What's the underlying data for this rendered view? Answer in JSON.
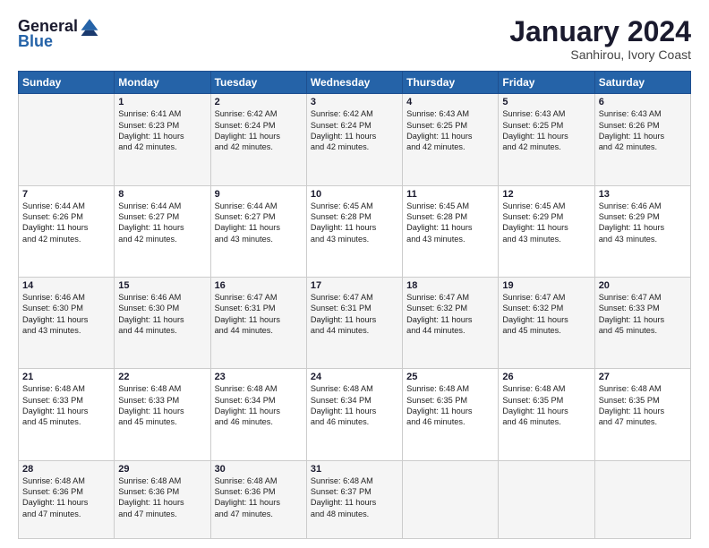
{
  "header": {
    "logo_general": "General",
    "logo_blue": "Blue",
    "month_title": "January 2024",
    "subtitle": "Sanhirou, Ivory Coast"
  },
  "weekdays": [
    "Sunday",
    "Monday",
    "Tuesday",
    "Wednesday",
    "Thursday",
    "Friday",
    "Saturday"
  ],
  "weeks": [
    [
      {
        "day": "",
        "info": ""
      },
      {
        "day": "1",
        "info": "Sunrise: 6:41 AM\nSunset: 6:23 PM\nDaylight: 11 hours\nand 42 minutes."
      },
      {
        "day": "2",
        "info": "Sunrise: 6:42 AM\nSunset: 6:24 PM\nDaylight: 11 hours\nand 42 minutes."
      },
      {
        "day": "3",
        "info": "Sunrise: 6:42 AM\nSunset: 6:24 PM\nDaylight: 11 hours\nand 42 minutes."
      },
      {
        "day": "4",
        "info": "Sunrise: 6:43 AM\nSunset: 6:25 PM\nDaylight: 11 hours\nand 42 minutes."
      },
      {
        "day": "5",
        "info": "Sunrise: 6:43 AM\nSunset: 6:25 PM\nDaylight: 11 hours\nand 42 minutes."
      },
      {
        "day": "6",
        "info": "Sunrise: 6:43 AM\nSunset: 6:26 PM\nDaylight: 11 hours\nand 42 minutes."
      }
    ],
    [
      {
        "day": "7",
        "info": "Sunrise: 6:44 AM\nSunset: 6:26 PM\nDaylight: 11 hours\nand 42 minutes."
      },
      {
        "day": "8",
        "info": "Sunrise: 6:44 AM\nSunset: 6:27 PM\nDaylight: 11 hours\nand 42 minutes."
      },
      {
        "day": "9",
        "info": "Sunrise: 6:44 AM\nSunset: 6:27 PM\nDaylight: 11 hours\nand 43 minutes."
      },
      {
        "day": "10",
        "info": "Sunrise: 6:45 AM\nSunset: 6:28 PM\nDaylight: 11 hours\nand 43 minutes."
      },
      {
        "day": "11",
        "info": "Sunrise: 6:45 AM\nSunset: 6:28 PM\nDaylight: 11 hours\nand 43 minutes."
      },
      {
        "day": "12",
        "info": "Sunrise: 6:45 AM\nSunset: 6:29 PM\nDaylight: 11 hours\nand 43 minutes."
      },
      {
        "day": "13",
        "info": "Sunrise: 6:46 AM\nSunset: 6:29 PM\nDaylight: 11 hours\nand 43 minutes."
      }
    ],
    [
      {
        "day": "14",
        "info": "Sunrise: 6:46 AM\nSunset: 6:30 PM\nDaylight: 11 hours\nand 43 minutes."
      },
      {
        "day": "15",
        "info": "Sunrise: 6:46 AM\nSunset: 6:30 PM\nDaylight: 11 hours\nand 44 minutes."
      },
      {
        "day": "16",
        "info": "Sunrise: 6:47 AM\nSunset: 6:31 PM\nDaylight: 11 hours\nand 44 minutes."
      },
      {
        "day": "17",
        "info": "Sunrise: 6:47 AM\nSunset: 6:31 PM\nDaylight: 11 hours\nand 44 minutes."
      },
      {
        "day": "18",
        "info": "Sunrise: 6:47 AM\nSunset: 6:32 PM\nDaylight: 11 hours\nand 44 minutes."
      },
      {
        "day": "19",
        "info": "Sunrise: 6:47 AM\nSunset: 6:32 PM\nDaylight: 11 hours\nand 45 minutes."
      },
      {
        "day": "20",
        "info": "Sunrise: 6:47 AM\nSunset: 6:33 PM\nDaylight: 11 hours\nand 45 minutes."
      }
    ],
    [
      {
        "day": "21",
        "info": "Sunrise: 6:48 AM\nSunset: 6:33 PM\nDaylight: 11 hours\nand 45 minutes."
      },
      {
        "day": "22",
        "info": "Sunrise: 6:48 AM\nSunset: 6:33 PM\nDaylight: 11 hours\nand 45 minutes."
      },
      {
        "day": "23",
        "info": "Sunrise: 6:48 AM\nSunset: 6:34 PM\nDaylight: 11 hours\nand 46 minutes."
      },
      {
        "day": "24",
        "info": "Sunrise: 6:48 AM\nSunset: 6:34 PM\nDaylight: 11 hours\nand 46 minutes."
      },
      {
        "day": "25",
        "info": "Sunrise: 6:48 AM\nSunset: 6:35 PM\nDaylight: 11 hours\nand 46 minutes."
      },
      {
        "day": "26",
        "info": "Sunrise: 6:48 AM\nSunset: 6:35 PM\nDaylight: 11 hours\nand 46 minutes."
      },
      {
        "day": "27",
        "info": "Sunrise: 6:48 AM\nSunset: 6:35 PM\nDaylight: 11 hours\nand 47 minutes."
      }
    ],
    [
      {
        "day": "28",
        "info": "Sunrise: 6:48 AM\nSunset: 6:36 PM\nDaylight: 11 hours\nand 47 minutes."
      },
      {
        "day": "29",
        "info": "Sunrise: 6:48 AM\nSunset: 6:36 PM\nDaylight: 11 hours\nand 47 minutes."
      },
      {
        "day": "30",
        "info": "Sunrise: 6:48 AM\nSunset: 6:36 PM\nDaylight: 11 hours\nand 47 minutes."
      },
      {
        "day": "31",
        "info": "Sunrise: 6:48 AM\nSunset: 6:37 PM\nDaylight: 11 hours\nand 48 minutes."
      },
      {
        "day": "",
        "info": ""
      },
      {
        "day": "",
        "info": ""
      },
      {
        "day": "",
        "info": ""
      }
    ]
  ]
}
